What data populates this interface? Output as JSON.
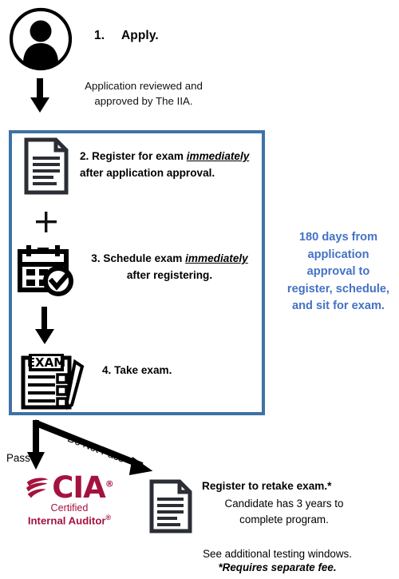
{
  "colors": {
    "box_border": "#3e72a5",
    "callout_text": "#4472c4",
    "cia_crimson": "#a4123f",
    "icon_dark": "#2b2e34",
    "black": "#000000"
  },
  "step1": {
    "number": "1.",
    "label": "Apply.",
    "icon": "person-avatar-icon",
    "note_line1": "Application reviewed and",
    "note_line2": "approved by The IIA."
  },
  "exam_window": {
    "step2": {
      "icon": "document-icon",
      "prefix": "2. Register for exam ",
      "emphasis": "immediately",
      "suffix": "after application approval."
    },
    "plus": "+",
    "step3": {
      "icon": "calendar-check-icon",
      "prefix": "3. Schedule exam ",
      "emphasis": "immediately",
      "suffix": "after registering."
    },
    "step4": {
      "icon": "exam-clipboard-pencil-icon",
      "label": "4. Take exam."
    }
  },
  "callout": {
    "line1": "180 days from",
    "line2": "application",
    "line3": "approval to",
    "line4": "register, schedule,",
    "line5": "and sit for exam."
  },
  "branches": {
    "pass_label": "Pass",
    "do_not_pass_label": "Do Not Pass"
  },
  "credential": {
    "wordmark": "CIA",
    "registered": "®",
    "sub_line1": "Certified",
    "sub_line2": "Internal Auditor",
    "sub_line2_mark": "®"
  },
  "retake": {
    "icon": "document-icon",
    "title": "Register to retake exam.*",
    "note_line1": "Candidate has 3 years to",
    "note_line2": "complete program."
  },
  "footer": {
    "testing_windows": "See additional testing windows.",
    "fee_note": "*Requires separate fee."
  }
}
